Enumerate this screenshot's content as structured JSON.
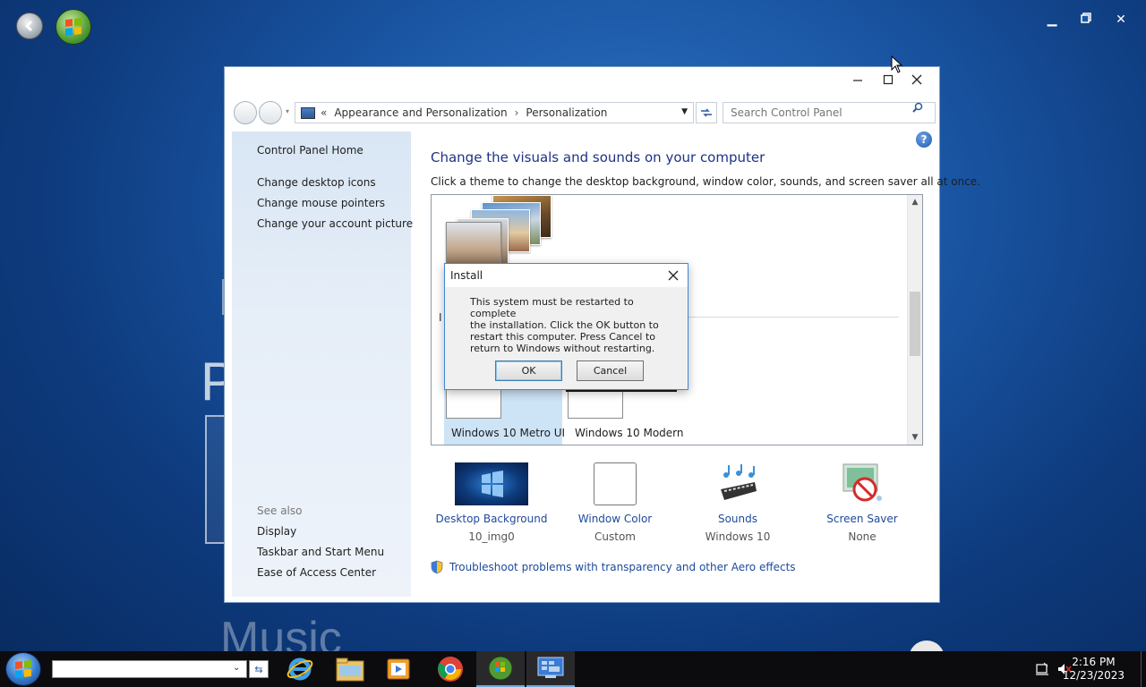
{
  "window": {
    "address": {
      "root_chevron": "«",
      "crumb1": "Appearance and Personalization",
      "crumb_sep": "›",
      "crumb2": "Personalization"
    },
    "search_placeholder": "Search Control Panel",
    "sidebar": {
      "home": "Control Panel Home",
      "links": [
        "Change desktop icons",
        "Change mouse pointers",
        "Change your account picture"
      ],
      "see_also_header": "See also",
      "see_also": [
        "Display",
        "Taskbar and Start Menu",
        "Ease of Access Center"
      ]
    },
    "main": {
      "title": "Change the visuals and sounds on your computer",
      "subtitle": "Click a theme to change the desktop background, window color, sounds, and screen saver all at once.",
      "themes": [
        {
          "name": "Windows 10 Metro UI",
          "selected": true
        },
        {
          "name": "Windows 10 Modern",
          "selected": false
        }
      ],
      "partial_label": "I",
      "options": [
        {
          "label": "Desktop Background",
          "value": "10_img0",
          "icon": "desktop-background-icon"
        },
        {
          "label": "Window Color",
          "value": "Custom",
          "icon": "window-color-icon"
        },
        {
          "label": "Sounds",
          "value": "Windows 10",
          "icon": "sounds-icon"
        },
        {
          "label": "Screen Saver",
          "value": "None",
          "icon": "screen-saver-icon"
        }
      ],
      "troubleshoot": "Troubleshoot problems with transparency and other Aero effects"
    }
  },
  "dialog": {
    "title": "Install",
    "message": "This system must be restarted to complete\nthe installation. Click the OK button to\nrestart this computer. Press Cancel to\nreturn to Windows without restarting.",
    "ok": "OK",
    "cancel": "Cancel"
  },
  "desktop": {
    "bg_letter": "P",
    "bg_word": "Music"
  },
  "taskbar": {
    "time": "2:16 PM",
    "date": "12/23/2023",
    "apps": [
      "internet-explorer-icon",
      "file-explorer-icon",
      "media-player-icon",
      "chrome-icon",
      "windows-orb-icon",
      "control-panel-icon"
    ]
  },
  "colors": {
    "accent": "#1e3287",
    "link": "#1e4a9a",
    "dialog_border": "#3d89d6",
    "selection": "#cde4f7"
  }
}
